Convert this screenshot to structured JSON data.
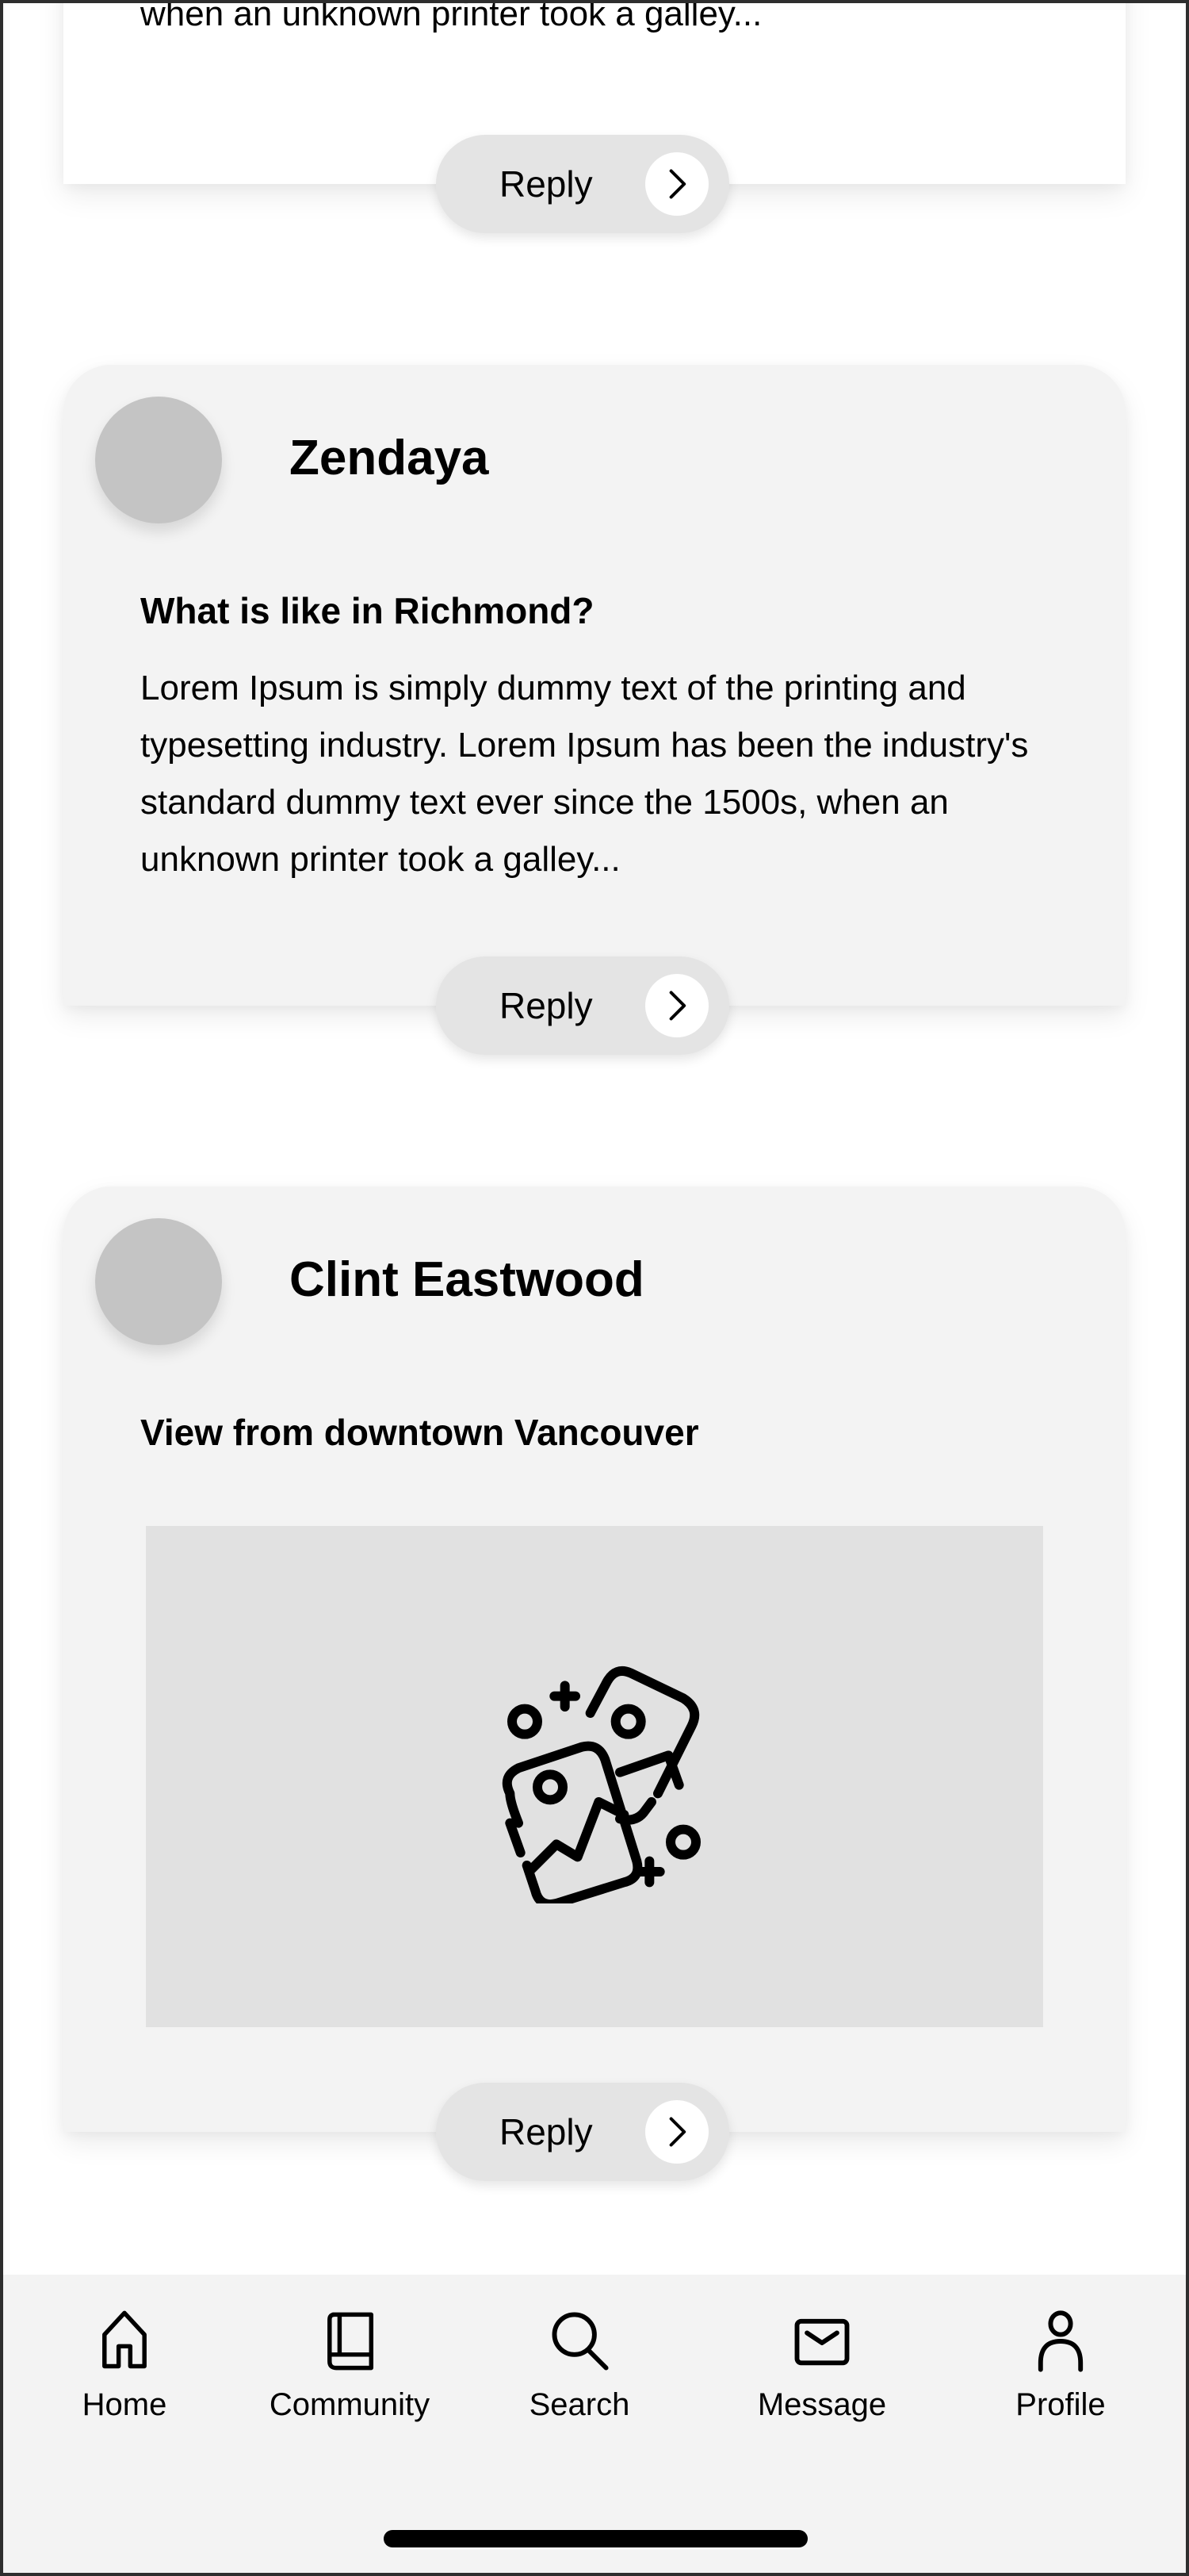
{
  "posts": [
    {
      "author": "",
      "title": "",
      "body_tail": "when an unknown printer took a galley...",
      "reply_label": "Reply"
    },
    {
      "author": "Zendaya",
      "title": "What is like in Richmond?",
      "body": "Lorem Ipsum is simply dummy text of the printing and typesetting industry. Lorem Ipsum has been the industry's standard dummy text ever since the 1500s, when an unknown printer took a galley...",
      "reply_label": "Reply"
    },
    {
      "author": "Clint Eastwood",
      "title": "View from downtown Vancouver",
      "image": "image-placeholder-icon",
      "reply_label": "Reply"
    }
  ],
  "nav": {
    "items": [
      {
        "label": "Home",
        "icon": "home-icon"
      },
      {
        "label": "Community",
        "icon": "book-icon"
      },
      {
        "label": "Search",
        "icon": "search-icon"
      },
      {
        "label": "Message",
        "icon": "mail-icon"
      },
      {
        "label": "Profile",
        "icon": "person-icon"
      }
    ]
  },
  "colors": {
    "card_bg": "#f3f3f3",
    "avatar": "#c4c4c4",
    "reply_bg": "#e4e4e4",
    "image_placeholder": "#e1e1e1",
    "nav_bg": "#f3f3f3"
  }
}
